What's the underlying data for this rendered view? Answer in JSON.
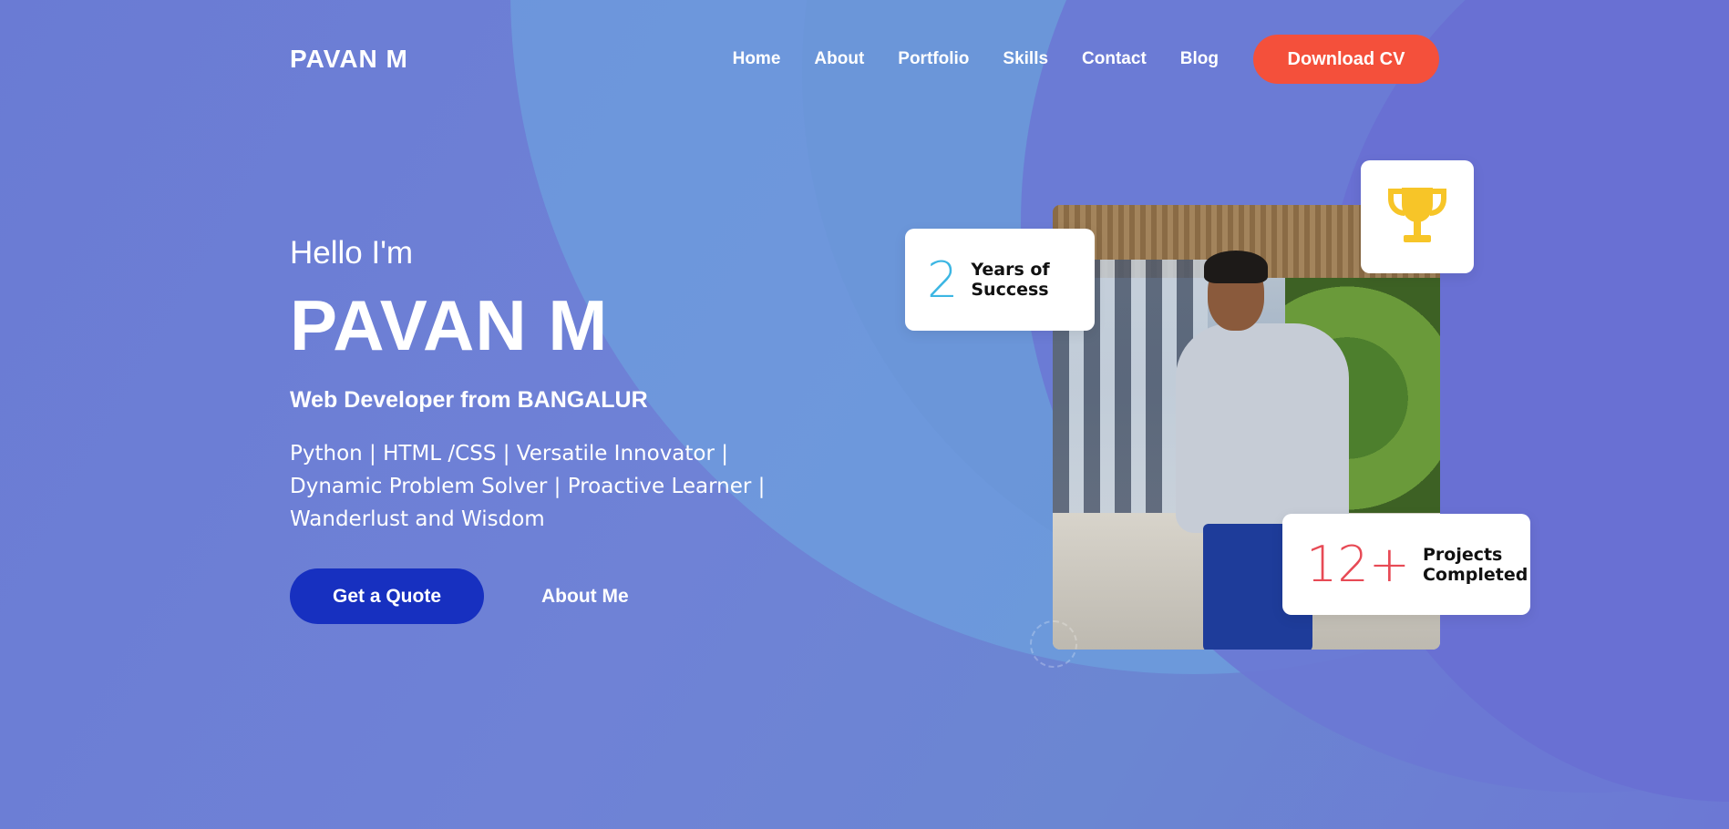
{
  "header": {
    "brand": "PAVAN M",
    "nav": [
      "Home",
      "About",
      "Portfolio",
      "Skills",
      "Contact",
      "Blog"
    ],
    "cta_label": "Download CV"
  },
  "hero": {
    "greeting": "Hello I'm",
    "name": "PAVAN M",
    "role": "Web Developer from BANGALUR",
    "description": "Python | HTML /CSS | Versatile Innovator | Dynamic Problem Solver | Proactive Learner | Wanderlust and Wisdom",
    "primary_button": "Get a Quote",
    "secondary_button": "About Me"
  },
  "stats": {
    "years": {
      "value": "2",
      "label_line1": "Years of",
      "label_line2": "Success"
    },
    "projects": {
      "value": "12+",
      "label_line1": "Projects",
      "label_line2": "Completed"
    }
  },
  "icons": {
    "trophy": "trophy-icon"
  },
  "colors": {
    "accent_orange": "#f4503b",
    "primary_blue": "#1730c0",
    "years_number": "#3cb6e3",
    "projects_number": "#e74a55",
    "trophy": "#f7c528",
    "background": "#6b7bd3"
  }
}
